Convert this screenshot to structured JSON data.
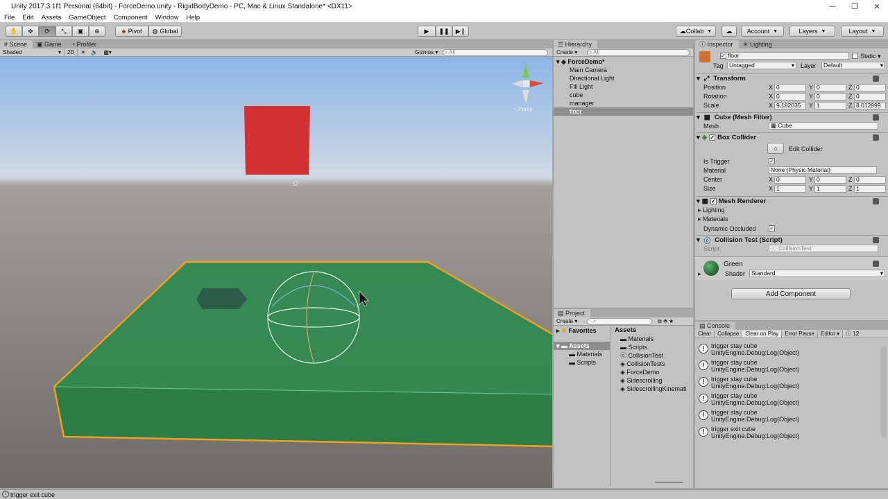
{
  "window": {
    "title": "Unity 2017.3.1f1 Personal (64bit) - ForceDemo.unity - RigidBodyDemo - PC, Mac & Linux Standalone* <DX11>"
  },
  "menu": [
    "File",
    "Edit",
    "Assets",
    "GameObject",
    "Component",
    "Window",
    "Help"
  ],
  "toolbar": {
    "pivot": "Pivot",
    "global": "Global",
    "collab": "Collab",
    "account": "Account",
    "layers": "Layers",
    "layout": "Layout"
  },
  "scene": {
    "tabs": [
      "Scene",
      "Game",
      "Profiler"
    ],
    "shading": "Shaded",
    "mode2d": "2D",
    "gizmos": "Gizmos",
    "search_placeholder": "All",
    "persp": "< Persp"
  },
  "hierarchy": {
    "tab": "Hierarchy",
    "create": "Create",
    "search_placeholder": "All",
    "scene": "ForceDemo*",
    "items": [
      "Main Camera",
      "Directional Light",
      "Fill Light",
      "cube",
      "manager",
      "floor"
    ],
    "selected_index": 5
  },
  "project": {
    "tab": "Project",
    "create": "Create",
    "favorites": "Favorites",
    "assets": "Assets",
    "tree_children": [
      "Materials",
      "Scripts"
    ],
    "assets_header": "Assets",
    "files": [
      "Materials",
      "Scripts",
      "CollisionTest",
      "CollisionTests",
      "ForceDemo",
      "Sidescrolling",
      "SidescrollingKinemati"
    ]
  },
  "inspector": {
    "tabs": [
      "Inspector",
      "Lighting"
    ],
    "object_name": "floor",
    "static": "Static",
    "tag_label": "Tag",
    "tag": "Untagged",
    "layer_label": "Layer",
    "layer": "Default",
    "transform": {
      "title": "Transform",
      "rows": [
        {
          "label": "Position",
          "x": "0",
          "y": "0",
          "z": "0"
        },
        {
          "label": "Rotation",
          "x": "0",
          "y": "0",
          "z": "0"
        },
        {
          "label": "Scale",
          "x": "9.182035",
          "y": "1",
          "z": "8.012999"
        }
      ]
    },
    "mesh_filter": {
      "title": "Cube (Mesh Filter)",
      "mesh_label": "Mesh",
      "mesh": "Cube"
    },
    "box_collider": {
      "title": "Box Collider",
      "edit": "Edit Collider",
      "is_trigger": "Is Trigger",
      "material_label": "Material",
      "material": "None (Physic Material)",
      "center": {
        "label": "Center",
        "x": "0",
        "y": "0",
        "z": "0"
      },
      "size": {
        "label": "Size",
        "x": "1",
        "y": "1",
        "z": "1"
      }
    },
    "mesh_renderer": {
      "title": "Mesh Renderer",
      "lighting": "Lighting",
      "materials": "Materials",
      "occluded": "Dynamic Occluded"
    },
    "script": {
      "title": "Collision Test (Script)",
      "label": "Script",
      "value": "CollisionTest"
    },
    "material": {
      "name": "Green",
      "shader_label": "Shader",
      "shader": "Standard"
    },
    "add_component": "Add Component"
  },
  "console": {
    "tab": "Console",
    "buttons": [
      "Clear",
      "Collapse",
      "Clear on Play",
      "Error Pause",
      "Editor"
    ],
    "count": "12",
    "logs": [
      {
        "msg": "trigger stay cube",
        "src": "UnityEngine.Debug:Log(Object)"
      },
      {
        "msg": "trigger stay cube",
        "src": "UnityEngine.Debug:Log(Object)"
      },
      {
        "msg": "trigger stay cube",
        "src": "UnityEngine.Debug:Log(Object)"
      },
      {
        "msg": "trigger stay cube",
        "src": "UnityEngine.Debug:Log(Object)"
      },
      {
        "msg": "trigger stay cube",
        "src": "UnityEngine.Debug:Log(Object)"
      },
      {
        "msg": "trigger exit cube",
        "src": "UnityEngine.Debug:Log(Object)"
      }
    ]
  },
  "status": {
    "text": "trigger exit cube"
  },
  "colors": {
    "floor": "#2e8b4f",
    "cube": "#d32f2f",
    "selection": "#f0a020",
    "panel": "#c2c2c2"
  }
}
